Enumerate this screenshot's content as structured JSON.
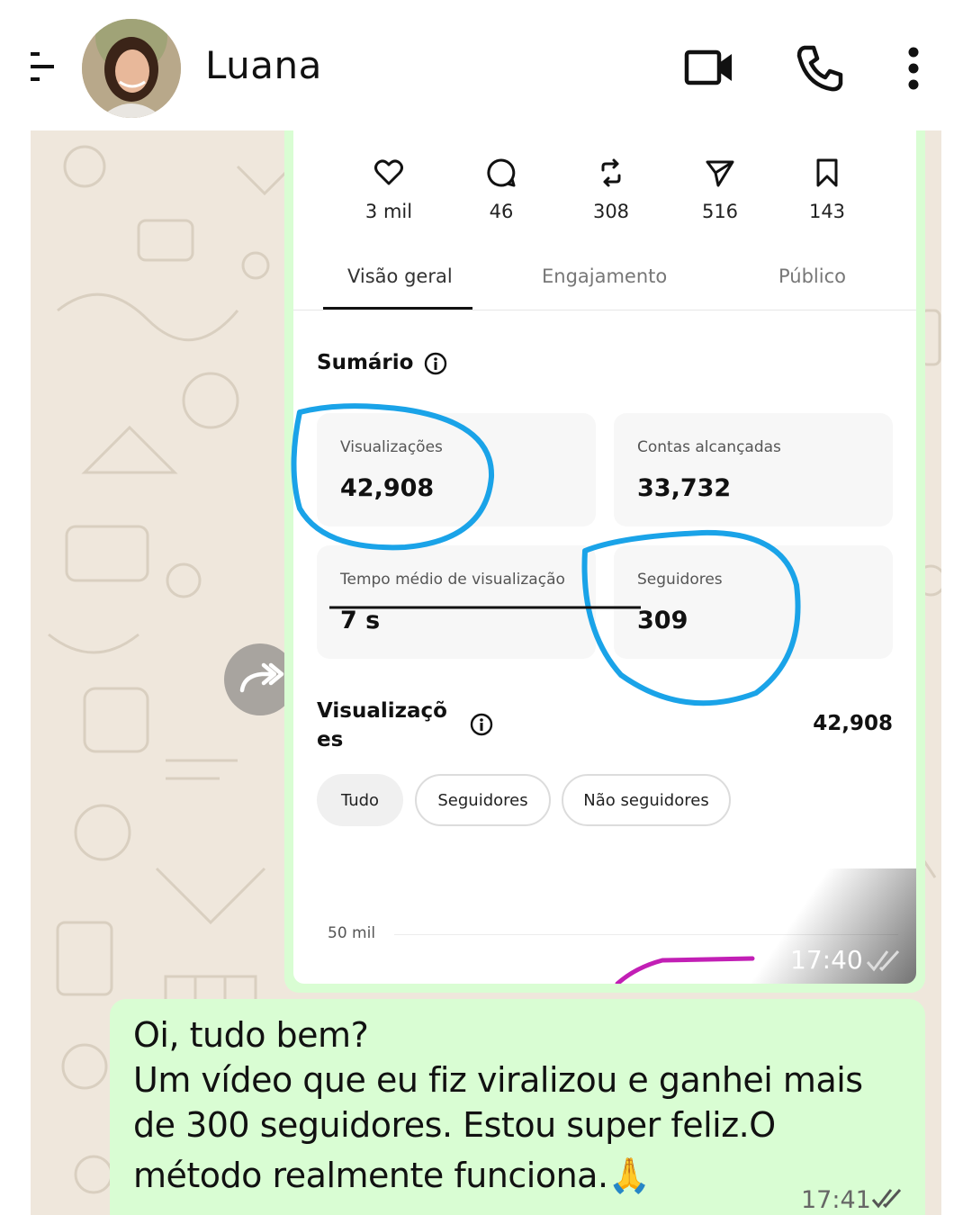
{
  "header": {
    "contact_name": "Luana",
    "icons": [
      "back-arrow-icon",
      "avatar",
      "video-call-icon",
      "phone-icon",
      "more-options-icon"
    ]
  },
  "shared_screenshot": {
    "stats": [
      {
        "icon": "heart-icon",
        "value": "3 mil"
      },
      {
        "icon": "comment-icon",
        "value": "46"
      },
      {
        "icon": "repost-icon",
        "value": "308"
      },
      {
        "icon": "send-icon",
        "value": "516"
      },
      {
        "icon": "bookmark-icon",
        "value": "143"
      }
    ],
    "tabs": [
      "Visão geral",
      "Engajamento",
      "Público"
    ],
    "summary_title": "Sumário",
    "cards": [
      {
        "label": "Visualizações",
        "value": "42,908"
      },
      {
        "label": "Contas alcançadas",
        "value": "33,732"
      },
      {
        "label": "Tempo médio de visualização",
        "value": "7 s"
      },
      {
        "label": "Seguidores",
        "value": "309"
      }
    ],
    "views_title_line1": "Visualizaçõ",
    "views_title_line2": "es",
    "views_total": "42,908",
    "filters": [
      "Tudo",
      "Seguidores",
      "Não seguidores"
    ],
    "axis_label": "50 mil",
    "timestamp": "17:40"
  },
  "message": {
    "lines": [
      "Oi, tudo bem?",
      "Um vídeo que eu fiz viralizou e ganhei mais",
      "de 300 seguidores. Estou super feliz.O",
      "método realmente funciona.🙏"
    ],
    "timestamp": "17:41"
  },
  "colors": {
    "chat_bg": "#efe7dc",
    "bubble_out": "#d9fdd3",
    "annotation_blue": "#1aa3e8",
    "chart_line": "#c21fb5"
  }
}
